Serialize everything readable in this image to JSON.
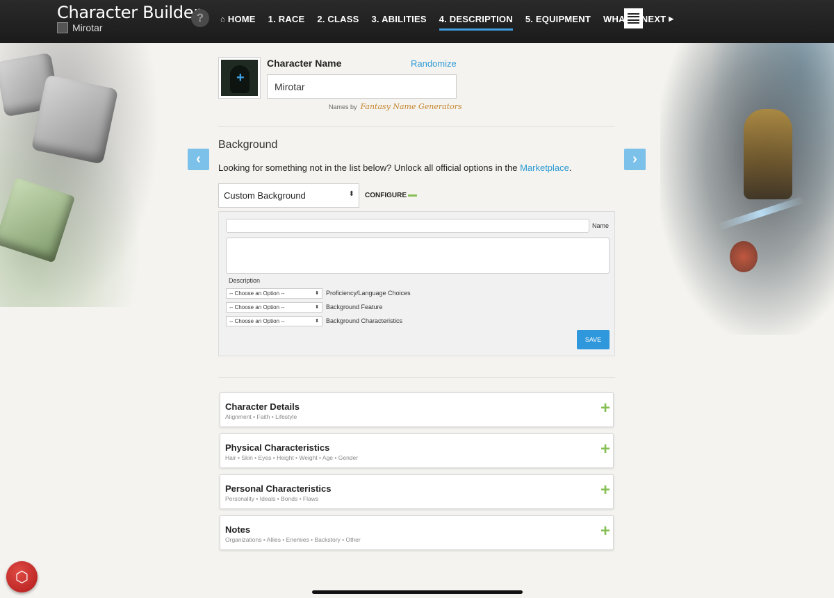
{
  "app": {
    "title": "Character Builder",
    "character_name": "Mirotar",
    "help_glyph": "?"
  },
  "nav": {
    "items": [
      {
        "label": "HOME",
        "icon": "home-icon"
      },
      {
        "label": "1. RACE"
      },
      {
        "label": "2. CLASS"
      },
      {
        "label": "3. ABILITIES"
      },
      {
        "label": "4. DESCRIPTION",
        "active": true
      },
      {
        "label": "5. EQUIPMENT"
      },
      {
        "label": "WHAT'S NEXT",
        "icon": "triangle-right-icon"
      }
    ]
  },
  "name_section": {
    "label": "Character Name",
    "randomize": "Randomize",
    "value": "Mirotar",
    "names_by": "Names by",
    "generator": "Fantasy Name Generators"
  },
  "background": {
    "title": "Background",
    "info_text": "Looking for something not in the list below? Unlock all official options in the ",
    "info_link": "Marketplace",
    "info_end": ".",
    "selected": "Custom Background",
    "configure": "CONFIGURE",
    "panel": {
      "name_label": "Name",
      "desc_label": "Description",
      "options": [
        {
          "value": "-- Choose an Option --",
          "label": "Proficiency/Language Choices"
        },
        {
          "value": "-- Choose an Option --",
          "label": "Background Feature"
        },
        {
          "value": "-- Choose an Option --",
          "label": "Background Characteristics"
        }
      ],
      "save": "SAVE"
    }
  },
  "cards": [
    {
      "title": "Character Details",
      "sub": "Alignment  •  Faith  •  Lifestyle"
    },
    {
      "title": "Physical Characteristics",
      "sub": "Hair  •  Skin  •  Eyes  •  Height  •  Weight  •  Age  •  Gender"
    },
    {
      "title": "Personal Characteristics",
      "sub": "Personality  •  Ideals  •  Bonds  •  Flaws"
    },
    {
      "title": "Notes",
      "sub": "Organizations  •  Allies  •  Enemies  •  Backstory  •  Other"
    }
  ],
  "colors": {
    "accent": "#2d9ad6",
    "plus_green": "#86bf53",
    "topbar": "#1b1b1b",
    "dice_red": "#c22222"
  }
}
